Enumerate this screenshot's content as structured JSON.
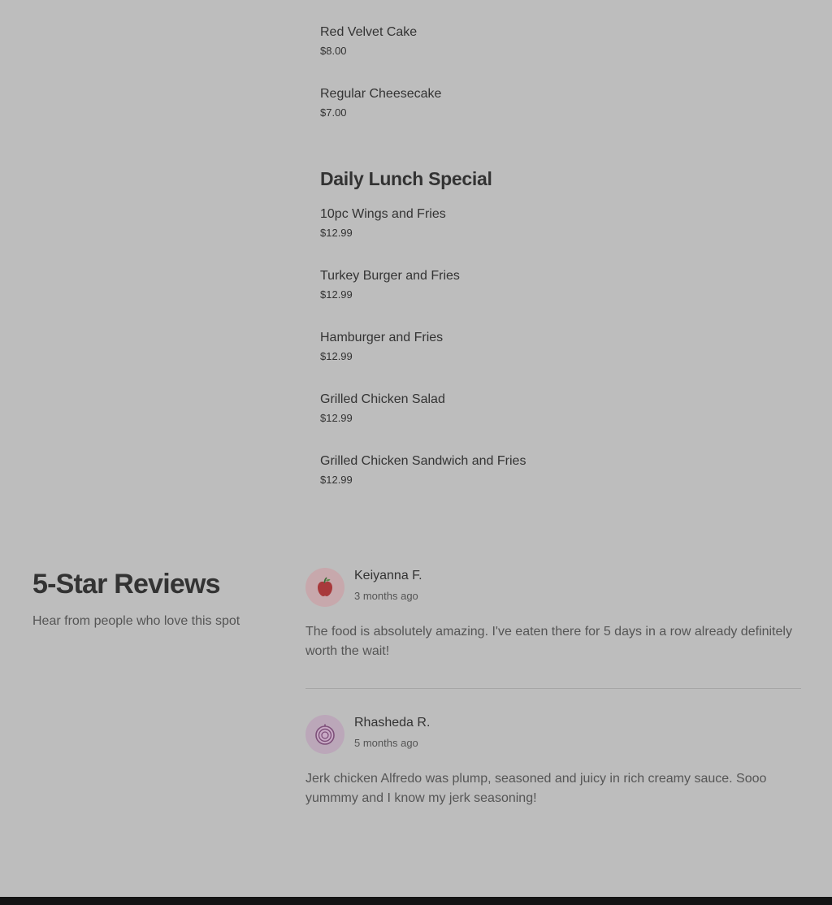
{
  "menu": {
    "dessert_items": [
      {
        "name": "Red Velvet Cake",
        "price": "$8.00"
      },
      {
        "name": "Regular Cheesecake",
        "price": "$7.00"
      }
    ],
    "lunch_special": {
      "title": "Daily Lunch Special",
      "items": [
        {
          "name": "10pc Wings and Fries",
          "price": "$12.99"
        },
        {
          "name": "Turkey Burger and Fries",
          "price": "$12.99"
        },
        {
          "name": "Hamburger and Fries",
          "price": "$12.99"
        },
        {
          "name": "Grilled Chicken Salad",
          "price": "$12.99"
        },
        {
          "name": "Grilled Chicken Sandwich and Fries",
          "price": "$12.99"
        }
      ]
    }
  },
  "reviews": {
    "heading": "5-Star Reviews",
    "subheading": "Hear from people who love this spot",
    "items": [
      {
        "name": "Keiyanna F.",
        "time": "3 months ago",
        "text": "The food is absolutely amazing. I've eaten there for 5 days in a row already definitely worth the wait!",
        "avatar_icon": "apple-icon",
        "avatar_color": "#c7a8ac"
      },
      {
        "name": "Rhasheda R.",
        "time": "5 months ago",
        "text": "Jerk chicken Alfredo was plump, seasoned and juicy in rich creamy sauce. Sooo yummmy and I know my jerk seasoning!",
        "avatar_icon": "onion-icon",
        "avatar_color": "#bba7b9"
      }
    ]
  },
  "colors": {
    "background": "#bdbdbd",
    "text": "#333333",
    "footer": "#141414"
  }
}
